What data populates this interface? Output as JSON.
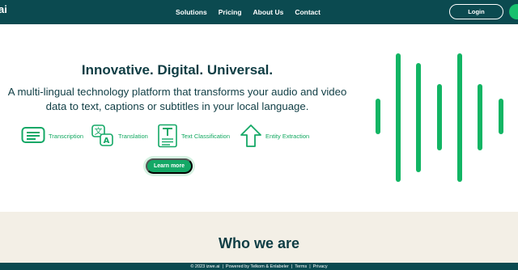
{
  "brand": {
    "logo_text": "ai"
  },
  "nav": {
    "items": [
      {
        "label": "Solutions"
      },
      {
        "label": "Pricing"
      },
      {
        "label": "About Us"
      },
      {
        "label": "Contact"
      }
    ],
    "login_label": "Login"
  },
  "hero": {
    "title": "Innovative. Digital. Universal.",
    "subtitle": "A multi-lingual technology platform that transforms your audio and video data to text, captions or subtitles in your local language.",
    "features": [
      {
        "label": "Transcription",
        "icon": "transcription-icon"
      },
      {
        "label": "Translation",
        "icon": "translation-icon"
      },
      {
        "label": "Text Classification",
        "icon": "text-classification-icon"
      },
      {
        "label": "Entity Extraction",
        "icon": "entity-extraction-icon"
      }
    ],
    "cta_label": "Learn more"
  },
  "who": {
    "title": "Who we are"
  },
  "footer": {
    "copyright": "© 2023 izwe.ai",
    "powered": "Powered by Telkom & Enlabeler",
    "terms": "Terms",
    "privacy": "Privacy",
    "separator": "|"
  },
  "colors": {
    "header_bg": "#0b4a50",
    "accent_green": "#14a866",
    "text_dark": "#0f3d44",
    "section_bg": "#f3efe6"
  }
}
